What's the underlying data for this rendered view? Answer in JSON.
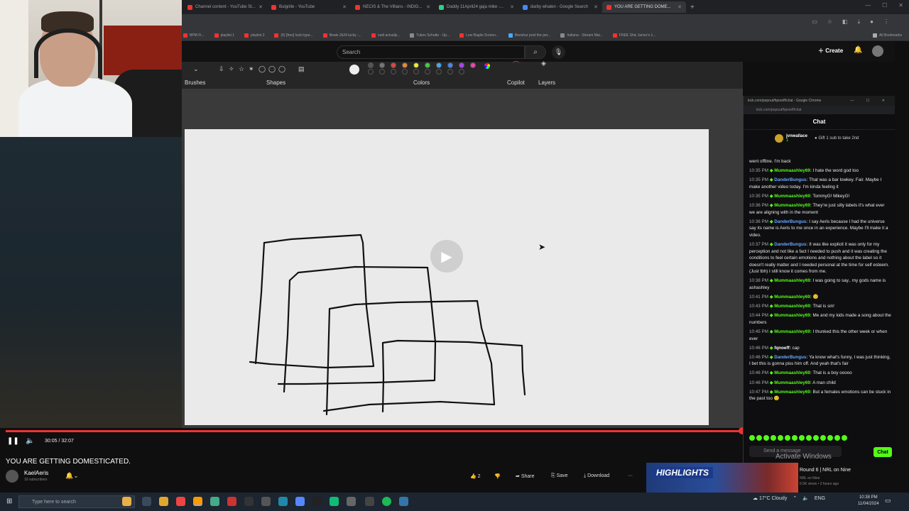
{
  "browser": {
    "tabs": [
      "Channel content - YouTube St...",
      "Bulgrille - YouTube",
      "NECIS & The Villians - INDIG...",
      "Daddy 11April24 gaja mike -...",
      "darby whalen - Google Search",
      "YOU ARE GETTING DOME..."
    ],
    "new_tab": "+",
    "bookmarks": [
      "BPM Fi...",
      "playlist 1",
      "playlist 2",
      "(6) [free] lucki type...",
      "Beats 2k24 lucky -...",
      "outil actually...",
      "Tubes Schutte - Up...",
      "Lew Baglio Screen...",
      "Beeshur pool the per...",
      "Indiana - Stream Mai...",
      "FREE Shiz Jarrez's 1..."
    ],
    "all_bookmarks": "All Bookmarks"
  },
  "app": {
    "search_placeholder": "Search",
    "create_label": "Create"
  },
  "paint": {
    "sections": [
      "Brushes",
      "Shapes",
      "Colors",
      "Copilot",
      "Layers"
    ]
  },
  "player": {
    "time": "30:05 / 32:07",
    "progress_fraction": 0.937
  },
  "chat": {
    "titlebar": "kick.com/popout/fqnoeff/chat - Google Chrome",
    "url": "kick.com/popout/fqnoeff/chat",
    "header": "Chat",
    "pinned_user": "jvnwallace",
    "pinned_sub": "1",
    "gift_text": "Gift 1 sub to take 2nd",
    "messages": [
      {
        "time": "",
        "user": "",
        "text": "went offline. I'm back",
        "color": "#e8e8e8"
      },
      {
        "time": "10:35 PM",
        "user": "Mummaashley69:",
        "text": "I hate the word god too",
        "color": "#53fc18"
      },
      {
        "time": "10:35 PM",
        "user": "DanderBungus:",
        "text": "That was a bar lowkey. Fair. Maybe I make another video today. I'm kinda feeling it",
        "color": "#6aa7ff"
      },
      {
        "time": "10:35 PM",
        "user": "Mummaashley69:",
        "text": "TommyG! MikeyG!",
        "color": "#53fc18"
      },
      {
        "time": "10:36 PM",
        "user": "Mummaashley69:",
        "text": "They're just silly labels it's what ever we are aligning with in the moment",
        "color": "#53fc18"
      },
      {
        "time": "10:36 PM",
        "user": "DanderBungus:",
        "text": "I say Aeris because I had the universe say its name is Aeris to me once in an experience. Maybe I'll make it a video.",
        "color": "#6aa7ff"
      },
      {
        "time": "10:37 PM",
        "user": "DanderBungus:",
        "text": "It was like explicit it was only for my perception and not like a fact I needed to push and it was creating the conditions to feel certain emotions and nothing about the label so it doesn't really matter and I needed personal at the time for self esteem. (Just tbh) I still know it comes from me.",
        "color": "#6aa7ff"
      },
      {
        "time": "10:38 PM",
        "user": "Mummaashley69:",
        "text": "I was going to say.. my gods name is ashashley",
        "color": "#53fc18"
      },
      {
        "time": "10:41 PM",
        "user": "Mummaashley69:",
        "text": "🙂",
        "color": "#53fc18"
      },
      {
        "time": "10:43 PM",
        "user": "Mummaashley69:",
        "text": "That is sin!",
        "color": "#53fc18"
      },
      {
        "time": "10:44 PM",
        "user": "Mummaashley69:",
        "text": "Me and my kids made a song about the numbers",
        "color": "#53fc18"
      },
      {
        "time": "10:45 PM",
        "user": "Mummaashley69:",
        "text": "I thunked this the other week or when ever",
        "color": "#53fc18"
      },
      {
        "time": "10:46 PM",
        "user": "fqnoeff:",
        "text": "cap",
        "color": "#ffffff"
      },
      {
        "time": "10:46 PM",
        "user": "DanderBungus:",
        "text": "Ya know what's funny, I was just thinking, I bet this is gonna piss him off. And yeah that's fair",
        "color": "#6aa7ff"
      },
      {
        "time": "10:46 PM",
        "user": "Mummaashley69:",
        "text": "That is a boy ooooo",
        "color": "#53fc18"
      },
      {
        "time": "10:46 PM",
        "user": "Mummaashley69:",
        "text": "A man child",
        "color": "#53fc18"
      },
      {
        "time": "10:47 PM",
        "user": "Mummaashley69:",
        "text": "But a females emotions can be stuck in the past too 🙂",
        "color": "#53fc18"
      }
    ],
    "input_placeholder": "Send a message",
    "send_label": "Chat"
  },
  "watermark": "Activate Windows",
  "video": {
    "title": "YOU ARE GETTING DOMESTICATED.",
    "channel": "KaelAeris",
    "subs": "19 subscribers",
    "likes": "2",
    "share": "Share",
    "save": "Save",
    "download": "Download",
    "more": "···"
  },
  "recommended": {
    "badge": "HIGHLIGHTS",
    "title": "Round 6 | NRL on Nine",
    "channel": "NRL on Nine",
    "meta": "6.5K views • 2 hours ago"
  },
  "taskbar": {
    "search_placeholder": "Type here to search",
    "weather": "17°C Cloudy",
    "lang": "ENG",
    "time": "10:38 PM",
    "date": "11/04/2024"
  },
  "colors": {
    "accent_red": "#e33333",
    "kick_green": "#53fc18"
  }
}
